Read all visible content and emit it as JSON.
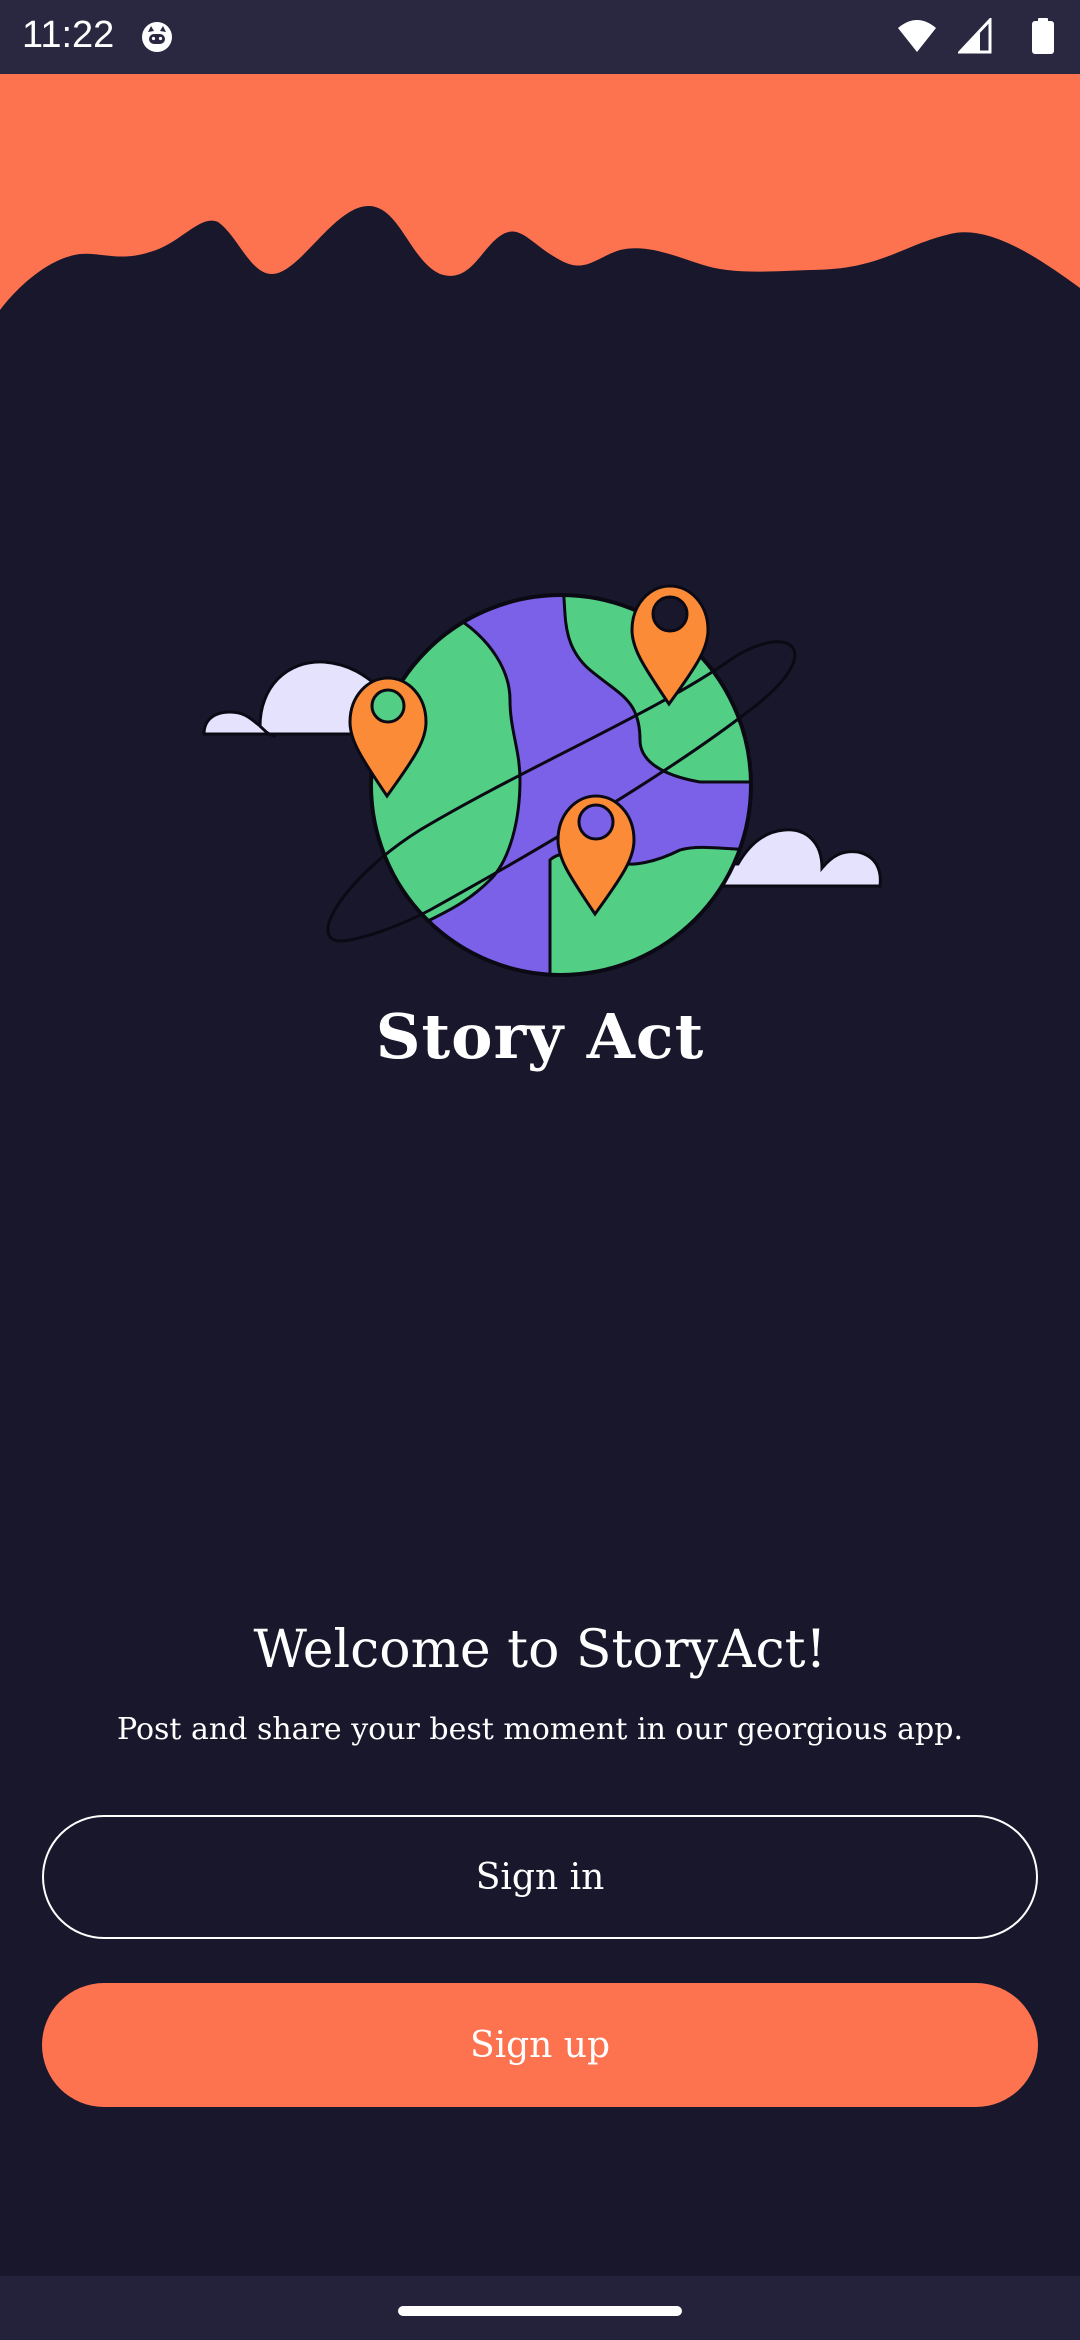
{
  "status_bar": {
    "time": "11:22",
    "app_icon": "cat-face-icon",
    "wifi_icon": "wifi-icon",
    "signal_icon": "cell-signal-icon",
    "battery_icon": "battery-icon"
  },
  "header": {
    "app_name": "Story Act"
  },
  "welcome": {
    "title": "Welcome to StoryAct!",
    "subtitle": "Post and share your best moment in our georgious app."
  },
  "actions": {
    "sign_in_label": "Sign in",
    "sign_up_label": "Sign up"
  },
  "colors": {
    "background": "#19172c",
    "accent": "#fe734f",
    "globe_purple": "#7b60e8",
    "globe_green": "#52cf85",
    "pin_orange": "#fb8b37",
    "cloud": "#e4e2fc"
  }
}
